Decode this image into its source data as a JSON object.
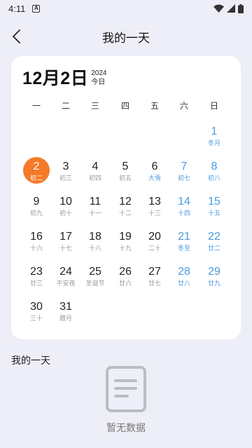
{
  "status_bar": {
    "time": "4:11",
    "notification_icon": "A"
  },
  "header": {
    "title": "我的一天"
  },
  "calendar": {
    "big_date": "12月2日",
    "year": "2024",
    "today_label": "今日",
    "weekdays": [
      "一",
      "二",
      "三",
      "四",
      "五",
      "六",
      "日"
    ],
    "days": [
      {
        "num": "1",
        "lunar": "冬月"
      },
      {
        "num": "2",
        "lunar": "初二"
      },
      {
        "num": "3",
        "lunar": "初三"
      },
      {
        "num": "4",
        "lunar": "初四"
      },
      {
        "num": "5",
        "lunar": "初五"
      },
      {
        "num": "6",
        "lunar": "大雪"
      },
      {
        "num": "7",
        "lunar": "初七"
      },
      {
        "num": "8",
        "lunar": "初八"
      },
      {
        "num": "9",
        "lunar": "初九"
      },
      {
        "num": "10",
        "lunar": "初十"
      },
      {
        "num": "11",
        "lunar": "十一"
      },
      {
        "num": "12",
        "lunar": "十二"
      },
      {
        "num": "13",
        "lunar": "十三"
      },
      {
        "num": "14",
        "lunar": "十四"
      },
      {
        "num": "15",
        "lunar": "十五"
      },
      {
        "num": "16",
        "lunar": "十六"
      },
      {
        "num": "17",
        "lunar": "十七"
      },
      {
        "num": "18",
        "lunar": "十八"
      },
      {
        "num": "19",
        "lunar": "十九"
      },
      {
        "num": "20",
        "lunar": "二十"
      },
      {
        "num": "21",
        "lunar": "冬至"
      },
      {
        "num": "22",
        "lunar": "廿二"
      },
      {
        "num": "23",
        "lunar": "廿三"
      },
      {
        "num": "24",
        "lunar": "平安夜"
      },
      {
        "num": "25",
        "lunar": "圣诞节"
      },
      {
        "num": "26",
        "lunar": "廿六"
      },
      {
        "num": "27",
        "lunar": "廿七"
      },
      {
        "num": "28",
        "lunar": "廿八"
      },
      {
        "num": "29",
        "lunar": "廿九"
      },
      {
        "num": "30",
        "lunar": "三十"
      },
      {
        "num": "31",
        "lunar": "腊月"
      }
    ]
  },
  "my_day": {
    "section_title": "我的一天",
    "empty_text": "暂无数据"
  },
  "colors": {
    "today": "#f47a28",
    "weekend": "#4a9be0",
    "background": "#eeeef8"
  }
}
